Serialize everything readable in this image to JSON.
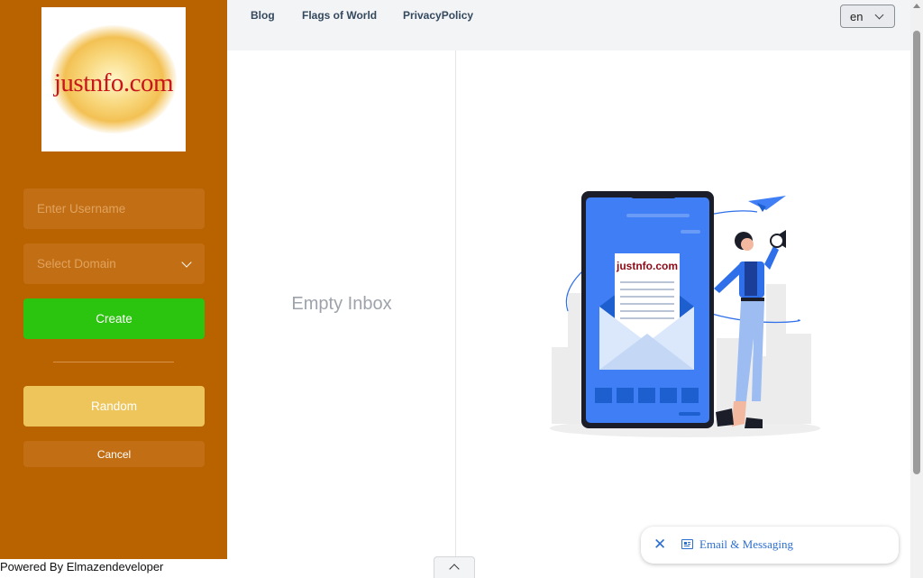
{
  "sidebar": {
    "logo_text": "justnfo.com",
    "username_placeholder": "Enter Username",
    "domain_select": "Select Domain",
    "create_label": "Create",
    "random_label": "Random",
    "cancel_label": "Cancel"
  },
  "nav": {
    "links": [
      "Blog",
      "Flags of World",
      "PrivacyPolicy"
    ],
    "language": "en"
  },
  "inbox": {
    "empty_text": "Empty Inbox",
    "illustration_letter_text": "justnfo.com"
  },
  "footer": {
    "powered_by": "Powered By Elmazendeveloper"
  },
  "chat_widget": {
    "label": "Email & Messaging",
    "close_symbol": "✕"
  },
  "colors": {
    "sidebar_bg": "#b86200",
    "create_button": "#2bc40e",
    "random_button": "#eec55a",
    "accent_blue": "#2d6fd1"
  },
  "icons": [
    "chevron-down-icon",
    "close-icon",
    "message-icon",
    "chevron-up-icon",
    "paper-plane-icon",
    "megaphone-icon"
  ]
}
